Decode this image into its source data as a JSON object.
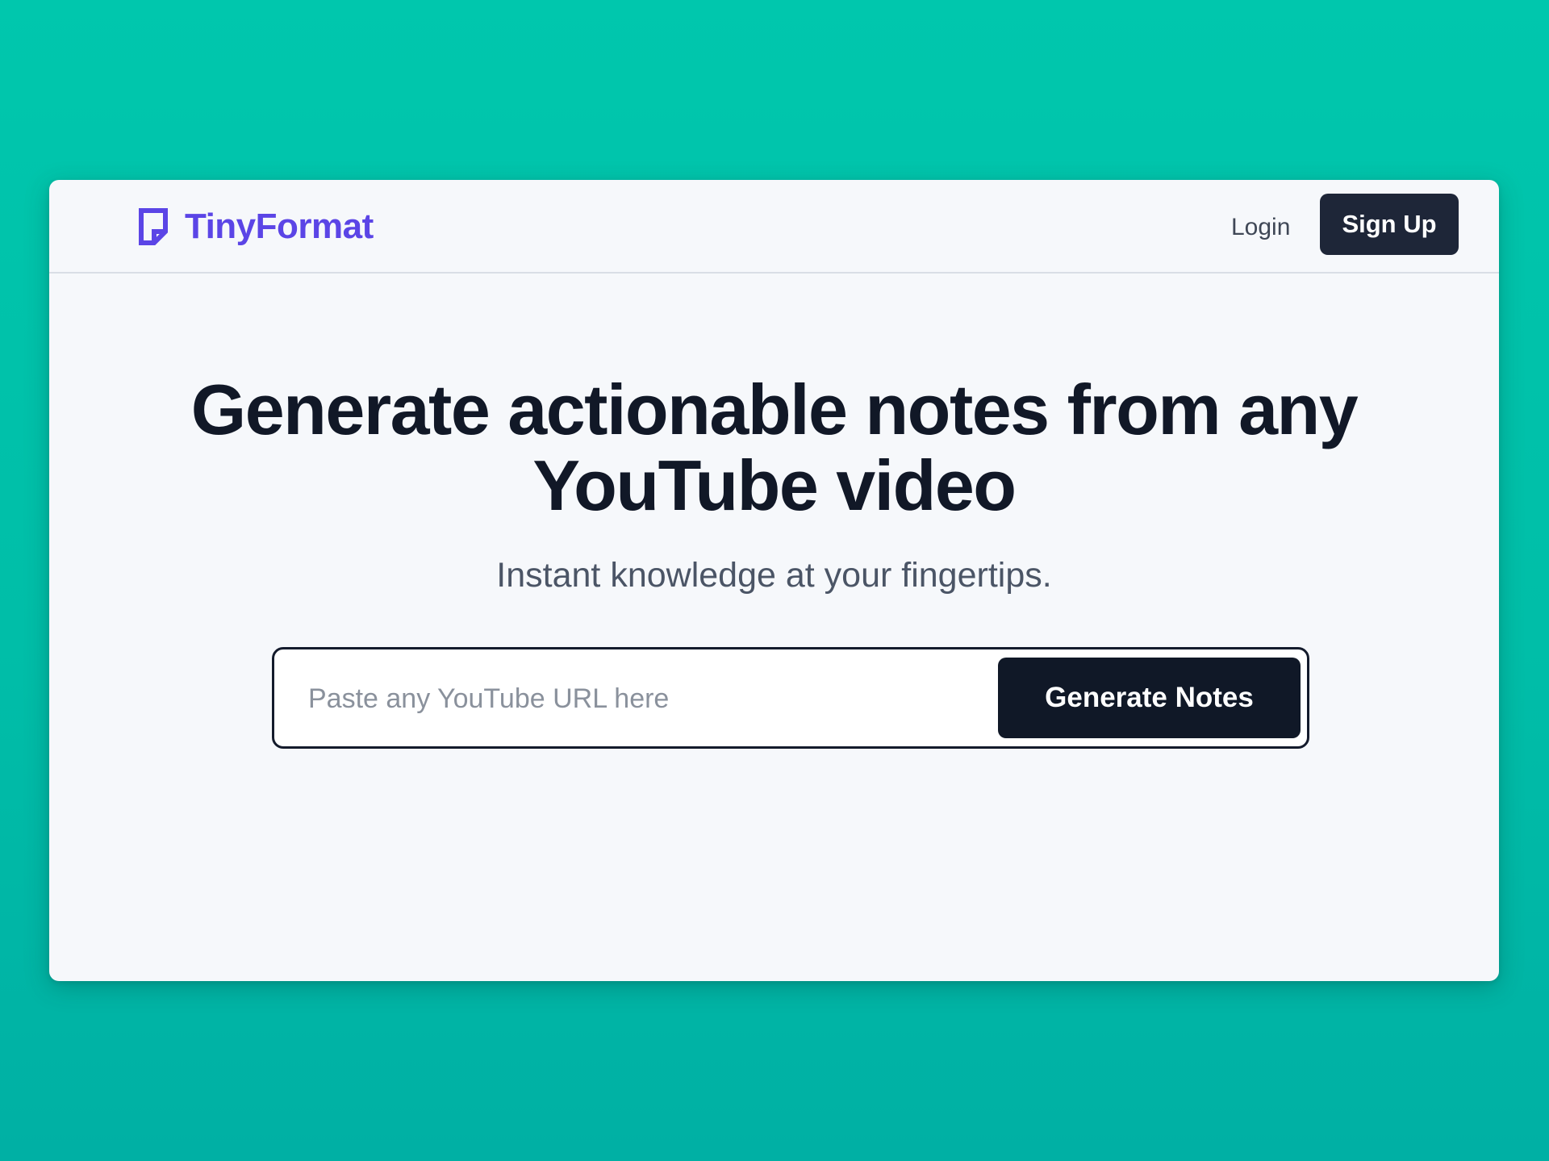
{
  "colors": {
    "background": "#00c1ac",
    "brand": "#5b45e6",
    "primary_dark": "#101827",
    "card": "#f6f8fb"
  },
  "navbar": {
    "brand": {
      "icon": "document-note-icon",
      "name": "TinyFormat"
    },
    "login_label": "Login",
    "signup_label": "Sign Up"
  },
  "hero": {
    "title": "Generate actionable notes from any YouTube video",
    "subtitle": "Instant knowledge at your fingertips."
  },
  "form": {
    "url_input": {
      "placeholder": "Paste any YouTube URL here",
      "value": ""
    },
    "submit_label": "Generate Notes"
  }
}
